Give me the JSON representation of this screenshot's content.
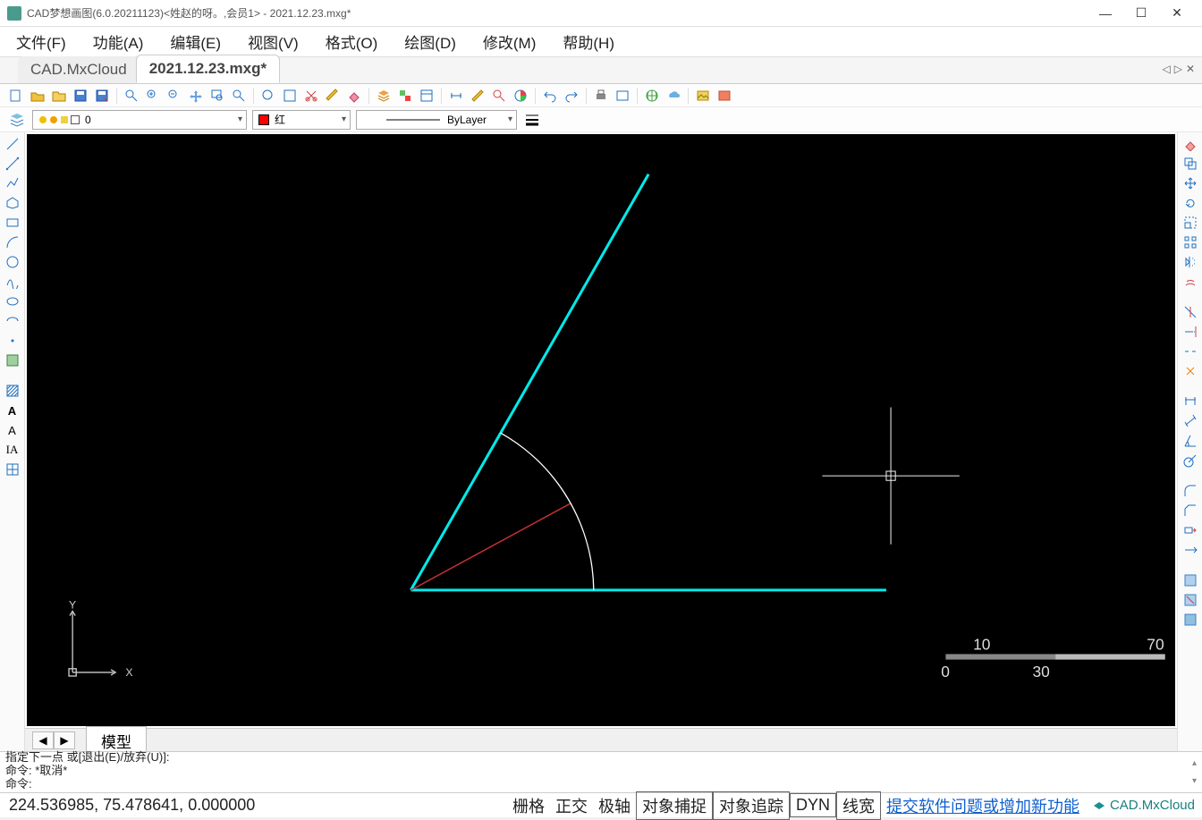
{
  "window": {
    "title": "CAD梦想画图(6.0.20211123)<姓赵的呀。,会员1> - 2021.12.23.mxg*"
  },
  "menu": {
    "file": "文件(F)",
    "function": "功能(A)",
    "edit": "编辑(E)",
    "view": "视图(V)",
    "format": "格式(O)",
    "draw": "绘图(D)",
    "modify": "修改(M)",
    "help": "帮助(H)"
  },
  "tabs": {
    "cloud": "CAD.MxCloud",
    "active": "2021.12.23.mxg*"
  },
  "layer": {
    "current": "0",
    "color_label": "红",
    "linetype": "ByLayer"
  },
  "viewport": {
    "model_tab": "模型",
    "ucs_y": "Y",
    "ucs_x": "X",
    "ruler": {
      "a": "10",
      "b": "70",
      "c": "0",
      "d": "30"
    }
  },
  "command": {
    "line1": "指定下一点 或[退出(E)/放弃(U)]:",
    "line2": "命令:  *取消*",
    "prompt": "命令:"
  },
  "status": {
    "coords": "224.536985,  75.478641,  0.000000",
    "grid": "栅格",
    "ortho": "正交",
    "polar": "极轴",
    "osnap": "对象捕捉",
    "otrack": "对象追踪",
    "dyn": "DYN",
    "lweight": "线宽",
    "feedback": "提交软件问题或增加新功能",
    "brand": "CAD.MxCloud"
  }
}
